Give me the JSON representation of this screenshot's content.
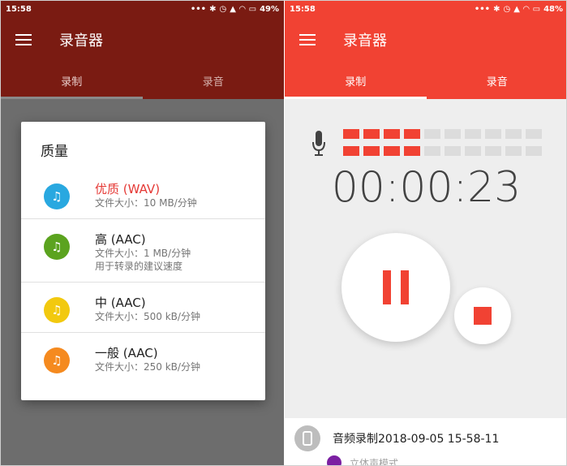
{
  "left": {
    "status": {
      "time": "15:58",
      "battery": "49%"
    },
    "app_title": "录音器",
    "tabs": [
      {
        "label": "录制"
      },
      {
        "label": "录音"
      }
    ],
    "dialog": {
      "title": "质量",
      "options": [
        {
          "title": "优质 (WAV)",
          "sub1": "文件大小：10 MB/分钟",
          "sub2": "",
          "color": "#29a8e0",
          "selected": true
        },
        {
          "title": "高 (AAC)",
          "sub1": "文件大小：1 MB/分钟",
          "sub2": "用于转录的建议速度",
          "color": "#5ba31f",
          "selected": false
        },
        {
          "title": "中 (AAC)",
          "sub1": "文件大小：500 kB/分钟",
          "sub2": "",
          "color": "#f2c90f",
          "selected": false
        },
        {
          "title": "一般 (AAC)",
          "sub1": "文件大小：250 kB/分钟",
          "sub2": "",
          "color": "#f58a1f",
          "selected": false
        }
      ]
    }
  },
  "right": {
    "status": {
      "time": "15:58",
      "battery": "48%"
    },
    "app_title": "录音器",
    "tabs": [
      {
        "label": "录制"
      },
      {
        "label": "录音"
      }
    ],
    "timer": "00:00:23",
    "recording": {
      "title": "音频录制2018-09-05 15-58-11",
      "mode": "立体声模式"
    },
    "accent_color": "#f14233"
  }
}
